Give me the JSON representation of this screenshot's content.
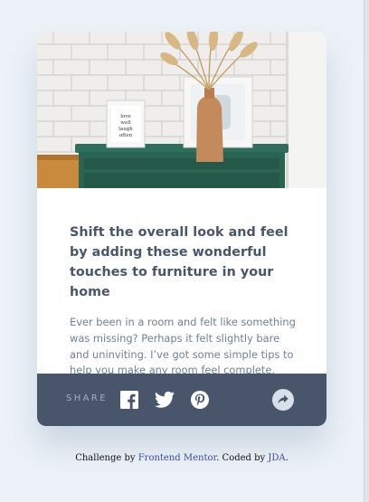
{
  "card": {
    "image_alt": "drawers",
    "frame_text": [
      "love",
      "well",
      "laugh",
      "often"
    ],
    "title": "Shift the overall look and feel by adding these wonderful touches to furniture in your home",
    "description": "Ever been in a room and felt like something was missing? Perhaps it felt slightly bare and uninviting. I’ve got some simple tips to help you make any room feel complete."
  },
  "footer": {
    "share_label": "SHARE",
    "icons": [
      "facebook-icon",
      "twitter-icon",
      "pinterest-icon",
      "share-icon"
    ]
  },
  "attribution": {
    "prefix": "Challenge by ",
    "link1": "Frontend Mentor",
    "middle": ". Coded by ",
    "link2": "JDA",
    "suffix": "."
  },
  "colors": {
    "page_bg": "#ecf2f8",
    "footer_bg": "#48556a",
    "title": "#48556a",
    "text": "#6e8098",
    "muted": "#9eafc2",
    "link": "#3b4ba0"
  }
}
